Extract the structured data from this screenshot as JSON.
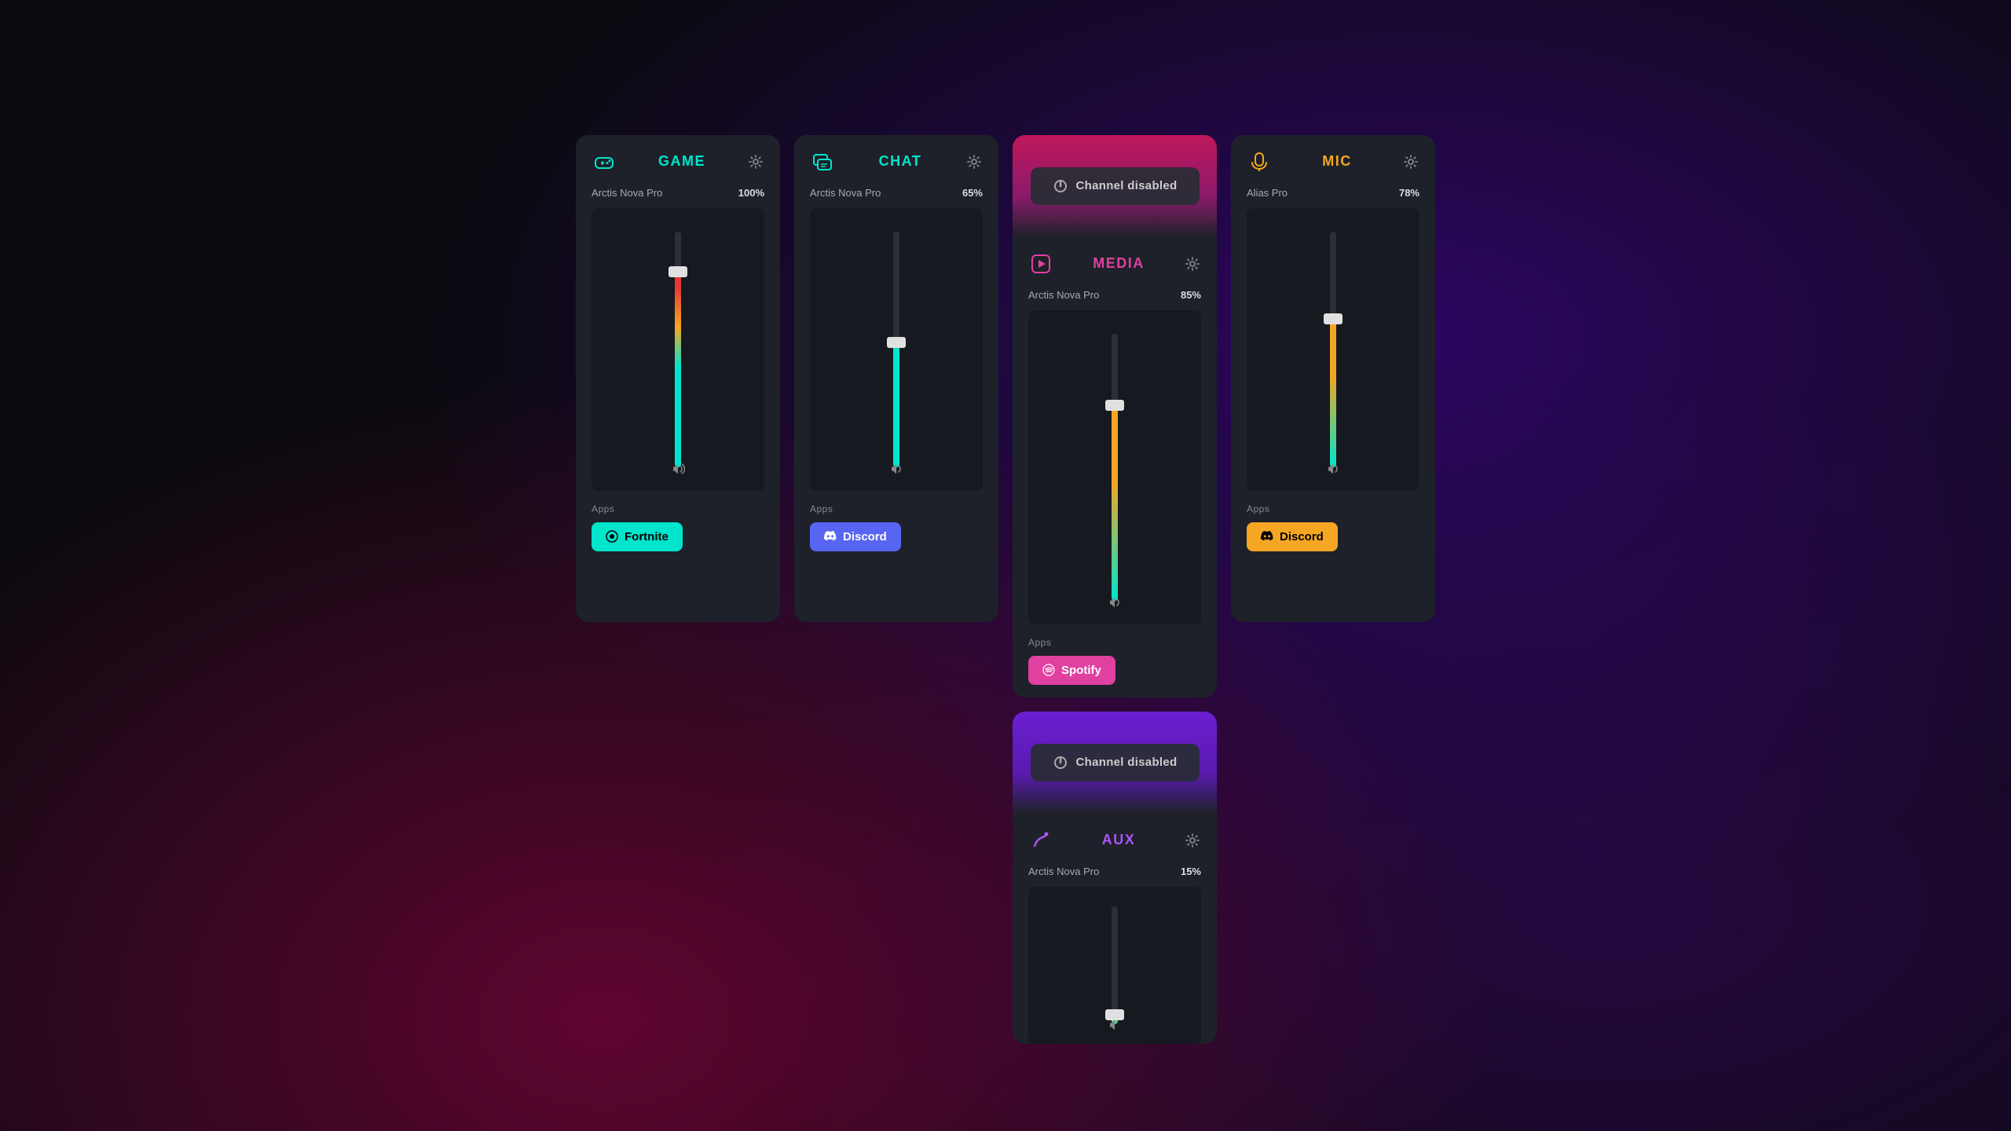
{
  "background": {
    "color": "#0a0a0f"
  },
  "panels": {
    "game": {
      "title": "GAME",
      "device": "Arctis Nova Pro",
      "percent": "100%",
      "volume": 85,
      "apps_label": "Apps",
      "app_button": "Fortnite",
      "settings_icon": "⚙",
      "icon": "🎮"
    },
    "chat": {
      "title": "CHAT",
      "device": "Arctis Nova Pro",
      "percent": "65%",
      "volume": 55,
      "apps_label": "Apps",
      "app_button": "Discord",
      "settings_icon": "⚙",
      "icon": "💬"
    },
    "media": {
      "title": "MEDIA",
      "device": "Arctis Nova Pro",
      "percent": "85%",
      "volume": 75,
      "channel_disabled": "Channel disabled",
      "apps_label": "Apps",
      "app_button": "Spotify",
      "settings_icon": "⚙",
      "icon": "▶"
    },
    "aux": {
      "title": "AUX",
      "device": "Arctis Nova Pro",
      "percent": "15%",
      "volume": 10,
      "channel_disabled": "Channel disabled",
      "settings_icon": "⚙",
      "icon": "✏"
    },
    "mic": {
      "title": "MIC",
      "device": "Alias Pro",
      "percent": "78%",
      "volume": 65,
      "apps_label": "Apps",
      "app_button": "Discord",
      "settings_icon": "⚙",
      "icon": "🎤"
    }
  }
}
